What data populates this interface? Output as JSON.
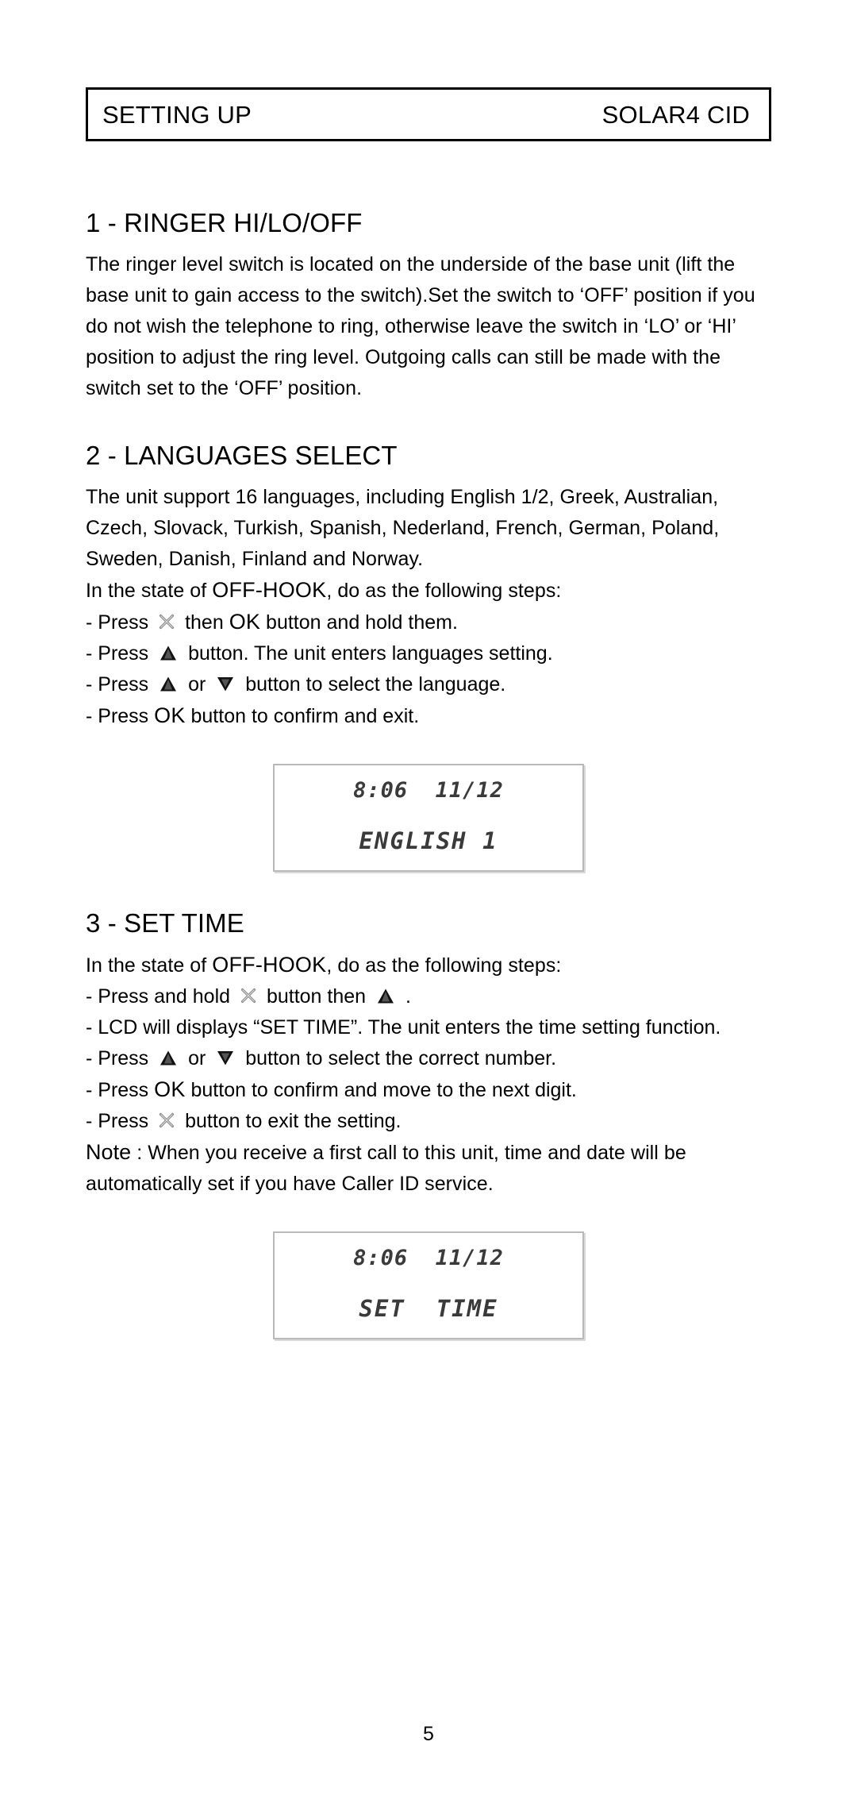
{
  "header": {
    "title": "SETTING UP",
    "model": "SOLAR4 CID"
  },
  "sections": [
    {
      "heading": "1 - RINGER HI/LO/OFF",
      "paragraph": "The ringer level switch is located on the underside of the base unit (lift the base unit to gain access to the switch).Set the switch to ‘OFF’ position if you do not wish the telephone to ring, otherwise leave the switch in ‘LO’ or ‘HI’ position to adjust the ring level. Outgoing calls can still be made with the switch set to the ‘OFF’ position."
    },
    {
      "heading": "2 - LANGUAGES SELECT",
      "intro": "The unit support 16 languages, including  English 1/2, Greek, Australian, Czech, Slovack, Turkish, Spanish, Nederland, French, German, Poland, Sweden, Danish, Finland and Norway.",
      "state_pre": "In the state of ",
      "state_key": "OFF-HOOK",
      "state_post": ", do as the following steps:",
      "steps": [
        {
          "pre": "- Press ",
          "icon": "x-key-icon",
          "mid": " then ",
          "key": "OK",
          "post": " button and hold them."
        },
        {
          "pre": "- Press ",
          "icon": "up-arrow-key-icon",
          "mid": " button. The unit enters languages setting."
        },
        {
          "pre": "- Press ",
          "icon": "up-arrow-key-icon",
          "mid": " or ",
          "icon2": "down-arrow-key-icon",
          "post": " button to select the language."
        },
        {
          "pre": "- Press ",
          "key": "OK",
          "post": " button to confirm and exit."
        }
      ],
      "lcd": {
        "top": "8:06  11/12",
        "bottom": "ENGLISH 1"
      }
    },
    {
      "heading": "3 - SET TIME",
      "state_pre": "In the state of ",
      "state_key": "OFF-HOOK",
      "state_post": ", do as the following steps:",
      "steps": [
        {
          "pre": "- Press and hold ",
          "icon": "x-key-icon",
          "mid": " button then ",
          "icon2": "up-arrow-key-icon",
          "post": " ."
        },
        {
          "pre": "- LCD will displays “SET TIME”. The unit enters the time setting function."
        },
        {
          "pre": "- Press ",
          "icon": "up-arrow-key-icon",
          "mid": " or ",
          "icon2": "down-arrow-key-icon",
          "post": " button to select the correct number."
        },
        {
          "pre": "- Press ",
          "key": "OK",
          "post": " button to confirm and move to the next digit."
        },
        {
          "pre": "- Press ",
          "icon": "x-key-icon",
          "mid": " button to exit the setting."
        }
      ],
      "note_label": "Note",
      "note_text": " : When you receive a first call to this unit, time and date will be automatically set if you have Caller ID service.",
      "lcd": {
        "top": "8:06  11/12",
        "bottom": "SET  TIME"
      }
    }
  ],
  "footer": {
    "page_number": "5"
  }
}
